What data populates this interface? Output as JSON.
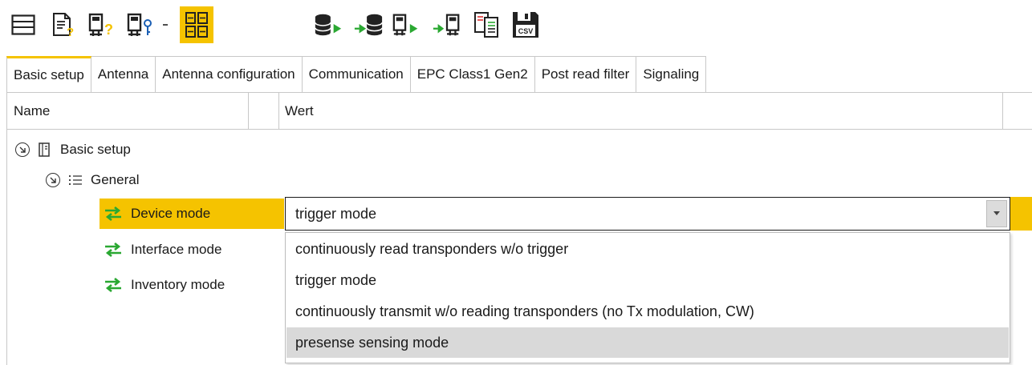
{
  "toolbar": {
    "icons": [
      {
        "name": "window-layout-icon"
      },
      {
        "name": "document-help-icon"
      },
      {
        "name": "reader-help-icon"
      },
      {
        "name": "reader-key-icon"
      },
      {
        "name": "dropdown-arrow-icon"
      },
      {
        "name": "grid-view-icon",
        "active": true
      },
      {
        "name": "database-export-icon"
      },
      {
        "name": "database-import-icon"
      },
      {
        "name": "reader-export-icon"
      },
      {
        "name": "reader-import-icon"
      },
      {
        "name": "compare-documents-icon"
      },
      {
        "name": "save-csv-icon",
        "badge": "CSV"
      }
    ],
    "accent": "#f5c300",
    "icon_green": "#2aa832"
  },
  "tabs": [
    {
      "label": "Basic setup",
      "active": true
    },
    {
      "label": "Antenna"
    },
    {
      "label": "Antenna configuration"
    },
    {
      "label": "Communication"
    },
    {
      "label": "EPC Class1 Gen2"
    },
    {
      "label": "Post read filter"
    },
    {
      "label": "Signaling"
    }
  ],
  "grid": {
    "col_name": "Name",
    "col_value": "Wert",
    "tree": {
      "root_label": "Basic setup",
      "group_label": "General",
      "properties": [
        {
          "label": "Device mode",
          "selected": true
        },
        {
          "label": "Interface mode"
        },
        {
          "label": "Inventory mode"
        }
      ]
    }
  },
  "combo": {
    "value": "trigger mode"
  },
  "dropdown": {
    "options": [
      "continuously read transponders w/o trigger",
      "trigger mode",
      "continuously transmit w/o reading transponders (no Tx modulation, CW)",
      "presense sensing mode"
    ],
    "highlighted_index": 3
  }
}
